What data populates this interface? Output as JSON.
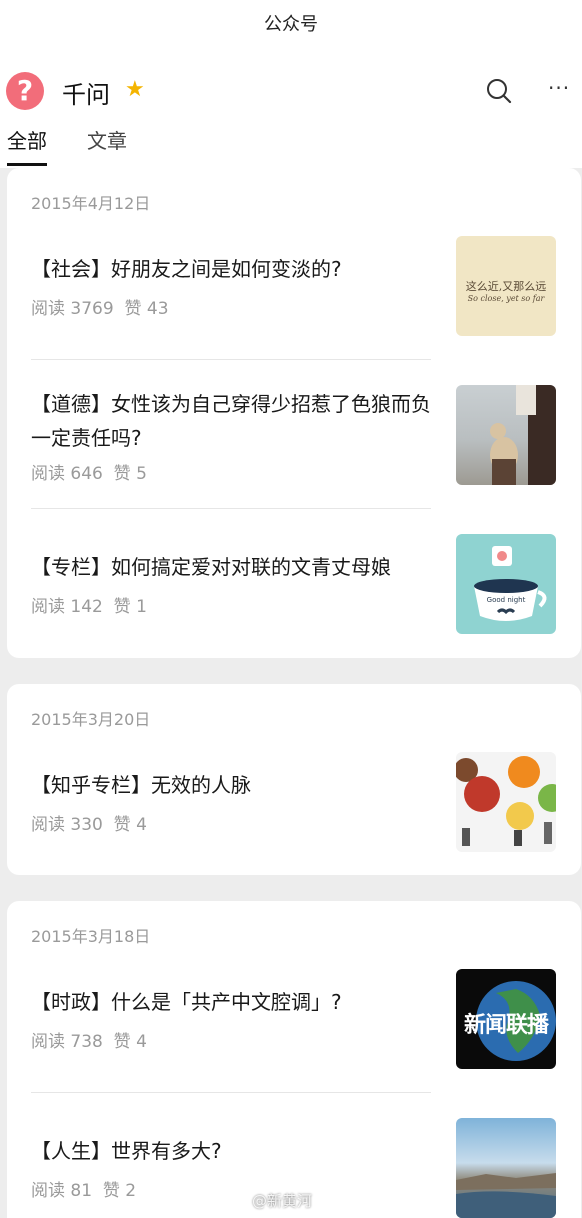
{
  "nav": {
    "title": "公众号"
  },
  "account": {
    "avatar_glyph": "?",
    "name": "千问",
    "star_glyph": "★",
    "more_glyph": "···"
  },
  "tabs": [
    {
      "label": "全部"
    },
    {
      "label": "文章"
    }
  ],
  "groups": [
    {
      "date": "2015年4月12日",
      "items": [
        {
          "title": "【社会】好朋友之间是如何变淡的?",
          "reads": "阅读 3769",
          "likes": "赞 43",
          "thumb_text": "这么近,又那么远",
          "thumb_subtext": "So close, yet so far"
        },
        {
          "title": "【道德】女性该为自己穿得少招惹了色狼而负一定责任吗?",
          "reads": "阅读 646",
          "likes": "赞 5"
        },
        {
          "title": "【专栏】如何搞定爱对对联的文青丈母娘",
          "reads": "阅读 142",
          "likes": "赞 1",
          "thumb_text": "Good night"
        }
      ]
    },
    {
      "date": "2015年3月20日",
      "items": [
        {
          "title": "【知乎专栏】无效的人脉",
          "reads": "阅读 330",
          "likes": "赞 4"
        }
      ]
    },
    {
      "date": "2015年3月18日",
      "items": [
        {
          "title": "【时政】什么是「共产中文腔调」?",
          "reads": "阅读 738",
          "likes": "赞 4",
          "thumb_text": "新闻联播"
        },
        {
          "title": "【人生】世界有多大?",
          "reads": "阅读 81",
          "likes": "赞 2"
        }
      ]
    }
  ],
  "watermark": "@新黄河",
  "colors": {
    "avatar": "#f26d7a",
    "star": "#f4b400",
    "meta": "#9a9a9a"
  }
}
